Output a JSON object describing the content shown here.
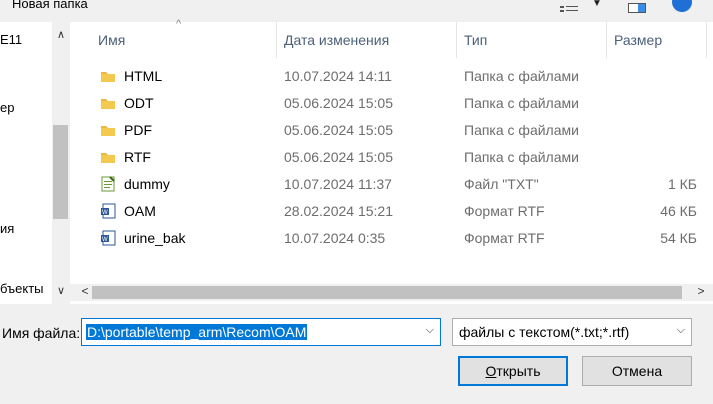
{
  "toolbar": {
    "new_folder": "Новая папка"
  },
  "nav": {
    "items": [
      "E11",
      "ер",
      "ия",
      "бъекты"
    ]
  },
  "columns": {
    "name": "Имя",
    "date": "Дата изменения",
    "type": "Тип",
    "size": "Размер"
  },
  "files": [
    {
      "name": "HTML",
      "date": "10.07.2024 14:11",
      "type": "Папка с файлами",
      "size": "",
      "icon": "folder-icon"
    },
    {
      "name": "ODT",
      "date": "05.06.2024 15:05",
      "type": "Папка с файлами",
      "size": "",
      "icon": "folder-icon"
    },
    {
      "name": "PDF",
      "date": "05.06.2024 15:05",
      "type": "Папка с файлами",
      "size": "",
      "icon": "folder-icon"
    },
    {
      "name": "RTF",
      "date": "05.06.2024 15:05",
      "type": "Папка с файлами",
      "size": "",
      "icon": "folder-icon"
    },
    {
      "name": "dummy",
      "date": "10.07.2024 11:37",
      "type": "Файл \"TXT\"",
      "size": "1 КБ",
      "icon": "text-file-icon"
    },
    {
      "name": "OAM",
      "date": "28.02.2024 15:21",
      "type": "Формат RTF",
      "size": "46 КБ",
      "icon": "word-doc-icon"
    },
    {
      "name": "urine_bak",
      "date": "10.07.2024 0:35",
      "type": "Формат RTF",
      "size": "54 КБ",
      "icon": "word-doc-icon"
    }
  ],
  "bottom": {
    "filename_label": "Имя файла:",
    "filename_value": "D:\\portable\\temp_arm\\Recom\\OAM",
    "filter_value": "файлы с текстом(*.txt;*.rtf)",
    "open_label": "Открыть",
    "cancel_label": "Отмена"
  },
  "colors": {
    "accent": "#0078d7",
    "folder": "#e8b83f"
  }
}
